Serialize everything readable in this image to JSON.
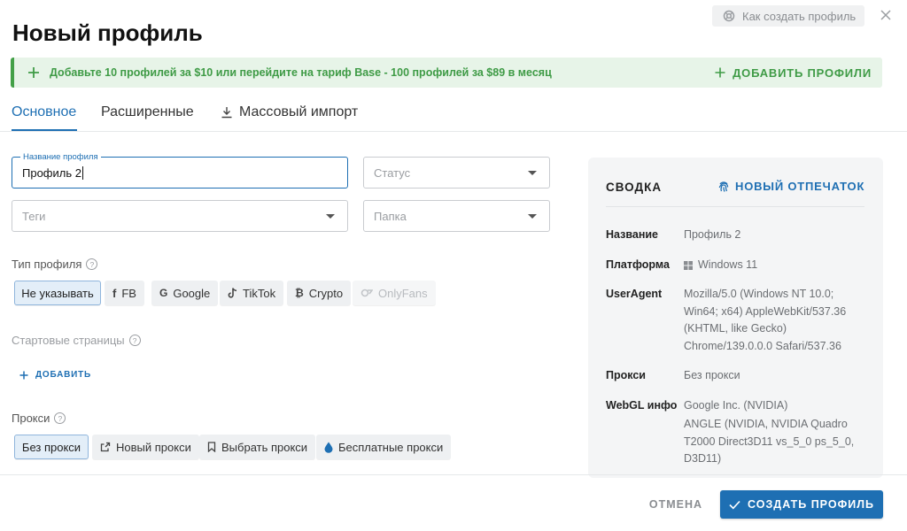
{
  "header": {
    "title": "Новый профиль",
    "help_label": "Как создать профиль"
  },
  "banner": {
    "text": "Добавьте 10 профилей за $10 или перейдите на тариф Base - 100 профилей за $89 в месяц",
    "action_label": "ДОБАВИТЬ ПРОФИЛИ"
  },
  "tabs": [
    {
      "label": "Основное",
      "active": true
    },
    {
      "label": "Расширенные",
      "active": false
    },
    {
      "label": "Массовый импорт",
      "active": false
    }
  ],
  "form": {
    "name": {
      "legend": "Название профиля",
      "value": "Профиль 2"
    },
    "status": {
      "placeholder": "Статус"
    },
    "tags": {
      "placeholder": "Теги"
    },
    "folder": {
      "placeholder": "Папка"
    }
  },
  "profile_type": {
    "label": "Тип профиля",
    "options": [
      {
        "label": "Не указывать",
        "icon": ""
      },
      {
        "label": "FB",
        "icon": "facebook-icon"
      },
      {
        "label": "Google",
        "icon": "google-icon"
      },
      {
        "label": "TikTok",
        "icon": "tiktok-icon"
      },
      {
        "label": "Crypto",
        "icon": "bitcoin-icon"
      },
      {
        "label": "OnlyFans",
        "icon": "onlyfans-icon"
      }
    ]
  },
  "start_pages": {
    "label": "Стартовые страницы",
    "add_label": "ДОБАВИТЬ"
  },
  "proxy": {
    "label": "Прокси",
    "options": [
      {
        "label": "Без прокси"
      },
      {
        "label": "Новый прокси"
      },
      {
        "label": "Выбрать прокси"
      },
      {
        "label": "Бесплатные прокси"
      }
    ]
  },
  "summary": {
    "title": "СВОДКА",
    "fingerprint_label": "НОВЫЙ ОТПЕЧАТОК",
    "rows": [
      {
        "key": "Название",
        "value": "Профиль 2"
      },
      {
        "key": "Платформа",
        "value": "Windows 11"
      },
      {
        "key": "UserAgent",
        "value": "Mozilla/5.0 (Windows NT 10.0; Win64; x64) AppleWebKit/537.36 (KHTML, like Gecko) Chrome/139.0.0.0 Safari/537.36"
      },
      {
        "key": "Прокси",
        "value": "Без прокси"
      },
      {
        "key": "WebGL инфо",
        "value": "Google Inc. (NVIDIA)",
        "value2": "ANGLE (NVIDIA, NVIDIA Quadro T2000 Direct3D11 vs_5_0 ps_5_0, D3D11)"
      }
    ]
  },
  "footer": {
    "cancel_label": "ОТМЕНА",
    "create_label": "СОЗДАТЬ ПРОФИЛЬ"
  },
  "colors": {
    "accent": "#1e6fb3",
    "banner_bg": "#e7f4e8",
    "banner_text": "#3f9b46"
  }
}
